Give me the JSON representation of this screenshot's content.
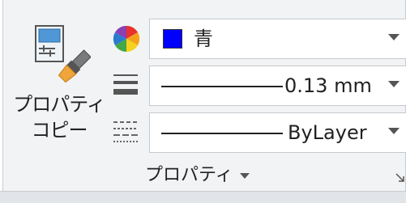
{
  "panel": {
    "title": "プロパティ",
    "match_properties": {
      "line1": "プロパティ",
      "line2": "コピー"
    }
  },
  "color_row": {
    "icon": "color-wheel-icon",
    "value": "青",
    "swatch_color": "#0000ff"
  },
  "lineweight_row": {
    "icon": "lineweight-icon",
    "value": "0.13 mm"
  },
  "linetype_row": {
    "icon": "linetype-icon",
    "value": "ByLayer"
  },
  "icons": {
    "match_properties": "match-properties-brush-icon",
    "dropdown": "chevron-down-icon",
    "launcher": "panel-launcher-icon"
  }
}
